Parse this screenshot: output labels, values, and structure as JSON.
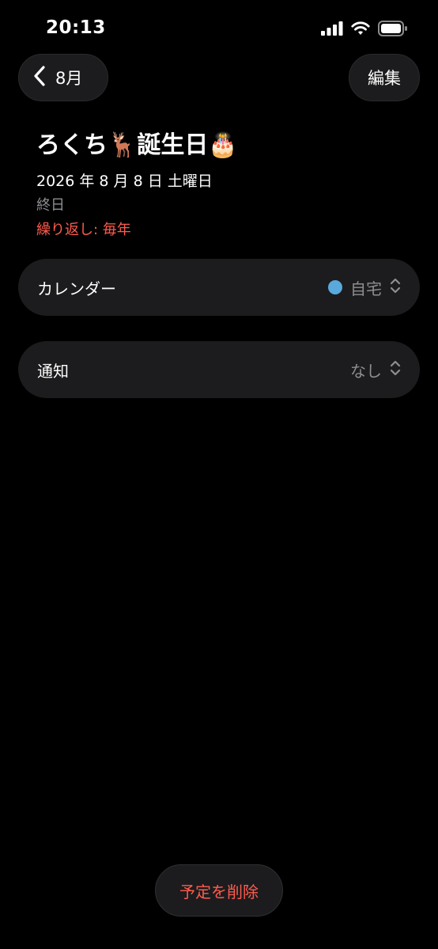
{
  "status_bar": {
    "time": "20:13"
  },
  "nav": {
    "back_label": "8月",
    "edit_label": "編集"
  },
  "event": {
    "title": "ろくち🦌誕生日🎂",
    "date": "2026 年 8 月 8 日 土曜日",
    "all_day": "終日",
    "repeat": "繰り返し: 毎年"
  },
  "rows": {
    "calendar": {
      "label": "カレンダー",
      "value": "自宅",
      "dot_color": "#5aa9dd"
    },
    "alert": {
      "label": "通知",
      "value": "なし"
    }
  },
  "delete_label": "予定を削除",
  "colors": {
    "accent_red": "#ff5b4f",
    "card_bg": "#1c1c1e"
  }
}
